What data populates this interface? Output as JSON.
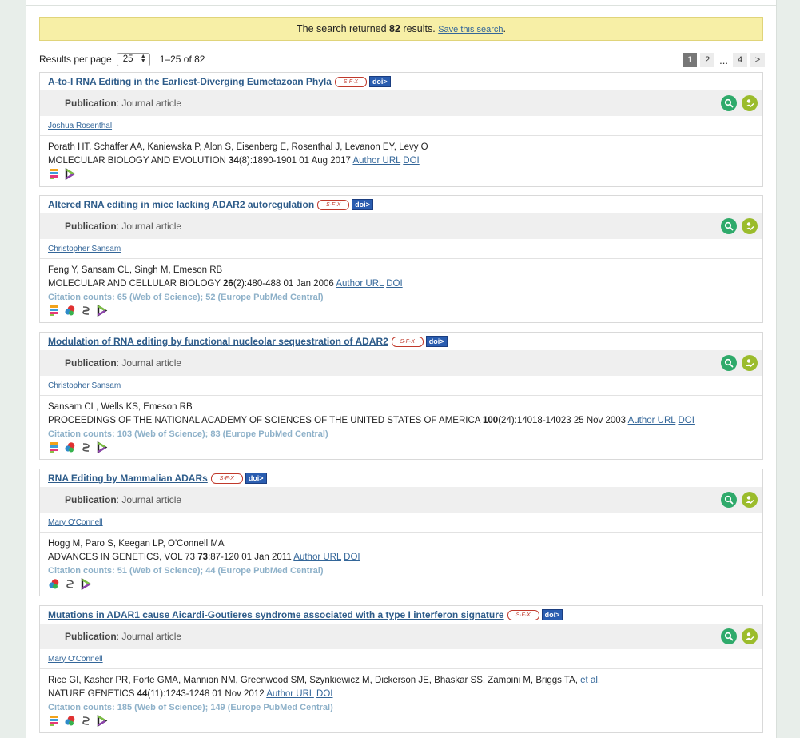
{
  "banner": {
    "prefix": "The search returned",
    "count": "82",
    "suffix": "results.",
    "save_link": "Save this search",
    "end": "."
  },
  "results_per_page": {
    "label": "Results per page",
    "value": "25",
    "range": "1–25 of 82"
  },
  "pagination": {
    "pages": [
      "1",
      "2",
      "4"
    ],
    "active": "1",
    "ellipsis": "...",
    "next": ">"
  },
  "icons": {
    "sfx": "S·F·X",
    "doi": "doi>",
    "search_icon": "magnifier",
    "action_icon": "person-edit"
  },
  "results": [
    {
      "title": "A-to-I RNA Editing in the Earliest-Diverging Eumetazoan Phyla",
      "type_label": "Publication",
      "type_value": ": Journal article",
      "owner": "Joshua Rosenthal",
      "authors": "Porath HT, Schaffer AA, Kaniewska P, Alon S, Eisenberg E, Rosenthal J, Levanon EY, Levy O",
      "journal": "MOLECULAR BIOLOGY AND EVOLUTION",
      "volume": "34",
      "issue_pages_date": "(8):1890-1901 01 Aug 2017",
      "author_url": "Author URL",
      "doi": "DOI",
      "citations": "",
      "badges": [
        "altmetric-icon",
        "dimensions-icon"
      ]
    },
    {
      "title": "Altered RNA editing in mice lacking ADAR2 autoregulation",
      "type_label": "Publication",
      "type_value": ": Journal article",
      "owner": "Christopher Sansam",
      "authors": "Feng Y, Sansam CL, Singh M, Emeson RB",
      "journal": "MOLECULAR AND CELLULAR BIOLOGY",
      "volume": "26",
      "issue_pages_date": "(2):480-488 01 Jan 2006",
      "author_url": "Author URL",
      "doi": "DOI",
      "citations": "Citation counts: 65 (Web of Science); 52 (Europe PubMed Central)",
      "badges": [
        "altmetric-icon",
        "europepmc-icon",
        "link-icon",
        "dimensions-icon"
      ]
    },
    {
      "title": "Modulation of RNA editing by functional nucleolar sequestration of ADAR2",
      "type_label": "Publication",
      "type_value": ": Journal article",
      "owner": "Christopher Sansam",
      "authors": "Sansam CL, Wells KS, Emeson RB",
      "journal": "PROCEEDINGS OF THE NATIONAL ACADEMY OF SCIENCES OF THE UNITED STATES OF AMERICA",
      "volume": "100",
      "issue_pages_date": "(24):14018-14023 25 Nov 2003",
      "author_url": "Author URL",
      "doi": "DOI",
      "citations": "Citation counts: 103 (Web of Science); 83 (Europe PubMed Central)",
      "badges": [
        "altmetric-icon",
        "europepmc-icon",
        "link-icon",
        "dimensions-icon"
      ]
    },
    {
      "title": "RNA Editing by Mammalian ADARs",
      "type_label": "Publication",
      "type_value": ": Journal article",
      "owner": "Mary O'Connell",
      "authors": "Hogg M, Paro S, Keegan LP, O'Connell MA",
      "journal": "ADVANCES IN GENETICS, VOL 73",
      "volume": "73",
      "issue_pages_date": ":87-120 01 Jan 2011",
      "author_url": "Author URL",
      "doi": "DOI",
      "citations": "Citation counts: 51 (Web of Science); 44 (Europe PubMed Central)",
      "badges": [
        "europepmc-icon",
        "link-icon",
        "dimensions-icon"
      ]
    },
    {
      "title": "Mutations in ADAR1 cause Aicardi-Goutieres syndrome associated with a type I interferon signature",
      "type_label": "Publication",
      "type_value": ": Journal article",
      "owner": "Mary O'Connell",
      "authors": "Rice GI, Kasher PR, Forte GMA, Mannion NM, Greenwood SM, Szynkiewicz M, Dickerson JE, Bhaskar SS, Zampini M, Briggs TA,",
      "et_al": "et al.",
      "journal": "NATURE GENETICS",
      "volume": "44",
      "issue_pages_date": "(11):1243-1248 01 Nov 2012",
      "author_url": "Author URL",
      "doi": "DOI",
      "citations": "Citation counts: 185 (Web of Science); 149 (Europe PubMed Central)",
      "badges": [
        "altmetric-icon",
        "europepmc-icon",
        "link-icon",
        "dimensions-icon"
      ]
    }
  ]
}
